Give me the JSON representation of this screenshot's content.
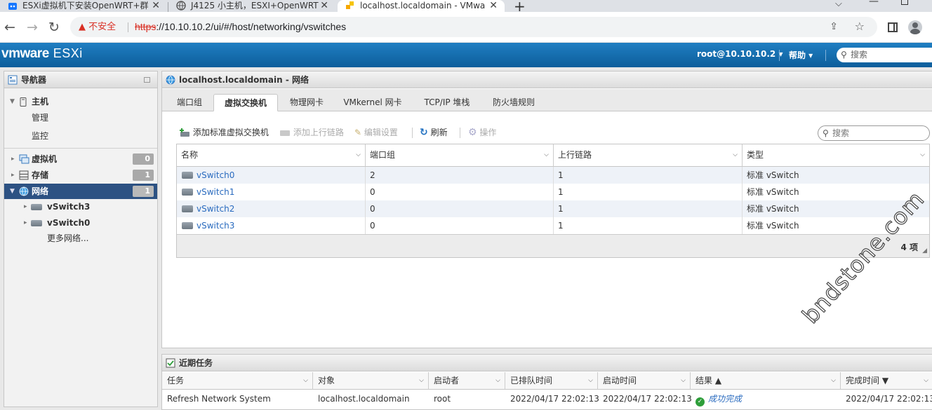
{
  "browser": {
    "tabs": [
      {
        "title": "ESXi虚拟机下安装OpenWRT+群"
      },
      {
        "title": "J4125 小主机，ESXI+OpenWRT"
      },
      {
        "title": "localhost.localdomain - VMwa"
      }
    ],
    "new_tab": "+",
    "security_label": "不安全",
    "url_scheme": "https",
    "url_rest": "://10.10.10.2/ui/#/host/networking/vswitches"
  },
  "header": {
    "logo_main": "vmware",
    "logo_product": "ESXi",
    "user": "root@10.10.10.2 ▾",
    "help": "帮助 ▾",
    "search_placeholder": "搜索"
  },
  "navigator": {
    "title": "导航器",
    "host": "主机",
    "host_children": [
      "管理",
      "监控"
    ],
    "vms": {
      "label": "虚拟机",
      "count": "0"
    },
    "storage": {
      "label": "存储",
      "count": "1"
    },
    "network": {
      "label": "网络",
      "count": "1"
    },
    "network_children": [
      "vSwitch3",
      "vSwitch0"
    ],
    "more_networks": "更多网络..."
  },
  "main": {
    "title": "localhost.localdomain - 网络",
    "tabs": [
      "端口组",
      "虚拟交换机",
      "物理网卡",
      "VMkernel 网卡",
      "TCP/IP 堆栈",
      "防火墙规则"
    ],
    "actions": {
      "add_vswitch": "添加标准虚拟交换机",
      "add_uplink": "添加上行链路",
      "edit_settings": "编辑设置",
      "refresh": "刷新",
      "actions": "操作"
    },
    "search_placeholder": "搜索",
    "columns": [
      "名称",
      "端口组",
      "上行链路",
      "类型"
    ],
    "rows": [
      {
        "name": "vSwitch0",
        "portgroups": "2",
        "uplinks": "1",
        "type": "标准 vSwitch"
      },
      {
        "name": "vSwitch1",
        "portgroups": "0",
        "uplinks": "1",
        "type": "标准 vSwitch"
      },
      {
        "name": "vSwitch2",
        "portgroups": "0",
        "uplinks": "1",
        "type": "标准 vSwitch"
      },
      {
        "name": "vSwitch3",
        "portgroups": "0",
        "uplinks": "1",
        "type": "标准 vSwitch"
      }
    ],
    "item_count": "4 项"
  },
  "tasks": {
    "title": "近期任务",
    "columns": [
      "任务",
      "对象",
      "启动者",
      "已排队时间",
      "启动时间",
      "结果 ▲",
      "完成时间 ▼"
    ],
    "row": {
      "task": "Refresh Network System",
      "object": "localhost.localdomain",
      "initiator": "root",
      "queued": "2022/04/17 22:02:13",
      "started": "2022/04/17 22:02:13",
      "result": "成功完成",
      "completed": "2022/04/17 22:02:13"
    }
  },
  "watermark": "bndstone.com"
}
